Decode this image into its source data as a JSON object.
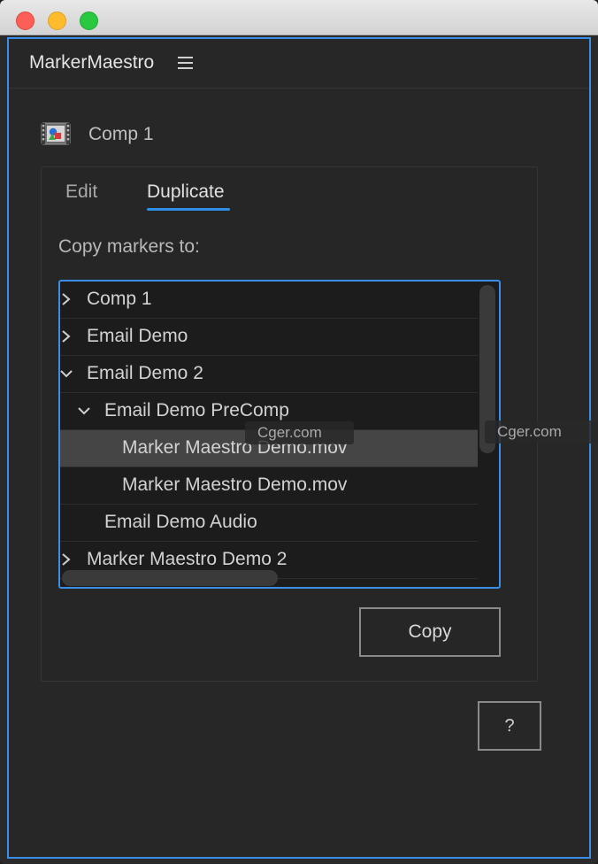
{
  "panel": {
    "title": "MarkerMaestro",
    "menu_icon": "hamburger-menu-icon"
  },
  "composition": {
    "icon": "composition-icon",
    "name": "Comp 1"
  },
  "tabs": [
    {
      "label": "Edit",
      "active": false
    },
    {
      "label": "Duplicate",
      "active": true
    }
  ],
  "copy_markers_label": "Copy markers to:",
  "tree": {
    "items": [
      {
        "label": "Comp 1",
        "expander": "chevron-right-icon",
        "level": 0,
        "selected": false
      },
      {
        "label": "Email Demo",
        "expander": "chevron-right-icon",
        "level": 0,
        "selected": false
      },
      {
        "label": "Email Demo 2",
        "expander": "chevron-down-icon",
        "level": 0,
        "selected": false
      },
      {
        "label": "Email Demo PreComp",
        "expander": "chevron-down-icon",
        "level": 1,
        "selected": false
      },
      {
        "label": "Marker Maestro Demo.mov",
        "expander": "",
        "level": 2,
        "selected": true
      },
      {
        "label": "Marker Maestro Demo.mov",
        "expander": "",
        "level": 2,
        "selected": false
      },
      {
        "label": "Email Demo Audio",
        "expander": "",
        "level": 1,
        "selected": false
      },
      {
        "label": "Marker Maestro Demo 2",
        "expander": "chevron-right-icon",
        "level": 0,
        "selected": false
      }
    ]
  },
  "buttons": {
    "copy": "Copy",
    "help": "?"
  },
  "watermarks": [
    "Cger.com",
    "Cger.com"
  ],
  "colors": {
    "accent": "#2f8ee8",
    "panel_bg": "#272727",
    "tree_bg": "#1c1c1c",
    "selected_row": "#454545"
  }
}
